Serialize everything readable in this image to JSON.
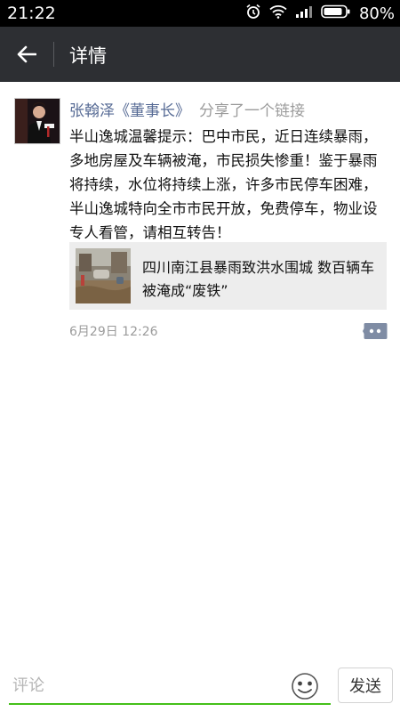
{
  "status_bar": {
    "time": "21:22",
    "battery_percent": "80%",
    "icons": [
      "alarm-icon",
      "wifi-icon",
      "signal-icon",
      "battery-icon"
    ]
  },
  "header": {
    "back_icon": "back-arrow-icon",
    "title": "详情",
    "background": "#2d2f33"
  },
  "post": {
    "author": "张翰泽《董事长》",
    "action": "分享了一个链接",
    "text": "半山逸城温馨提示：巴中市民，近日连续暴雨，多地房屋及车辆被淹，市民损失惨重！鉴于暴雨将持续，水位将持续上涨，许多市民停车困难，半山逸城特向全市市民开放，免费停车，物业设专人看管，请相互转告！",
    "link": {
      "title": "四川南江县暴雨致洪水围城 数百辆车被淹成“废铁”"
    },
    "time": "6月29日 12:26",
    "comment_icon": "comment-icon",
    "author_color": "#576b95"
  },
  "comment_bar": {
    "placeholder": "评论",
    "emoji_icon": "emoji-icon",
    "send_label": "发送",
    "accent": "#45c01a"
  }
}
